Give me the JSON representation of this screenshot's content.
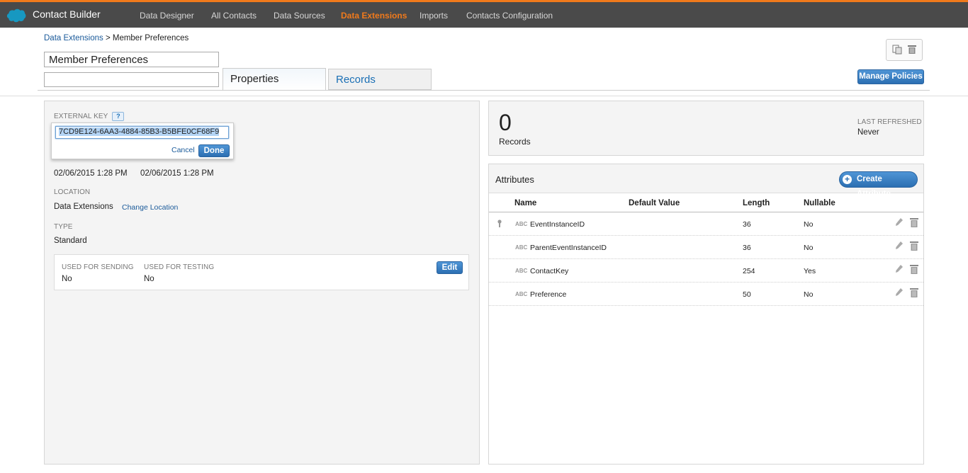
{
  "app": {
    "title": "Contact Builder"
  },
  "nav": [
    {
      "label": "Data Designer",
      "active": false
    },
    {
      "label": "All Contacts",
      "active": false
    },
    {
      "label": "Data Sources",
      "active": false
    },
    {
      "label": "Data Extensions",
      "active": true
    },
    {
      "label": "Imports",
      "active": false
    },
    {
      "label": "Contacts Configuration",
      "active": false
    }
  ],
  "breadcrumb": {
    "parent": "Data Extensions",
    "separator": " > ",
    "current": "Member Preferences"
  },
  "extension": {
    "name": "Member Preferences",
    "description": ""
  },
  "tabs": {
    "properties": "Properties",
    "records": "Records"
  },
  "toolbar": {
    "manage_policies": "Manage Policies"
  },
  "properties": {
    "external_key_label": "EXTERNAL KEY",
    "help": "?",
    "external_key_value": "7CD9E124-6AA3-4884-85B3-B5BFE0CF68F9",
    "cancel": "Cancel",
    "done": "Done",
    "created_value": "02/06/2015 1:28 PM",
    "modified_value": "02/06/2015 1:28 PM",
    "location_label": "LOCATION",
    "location_value": "Data Extensions",
    "change_location": "Change Location",
    "type_label": "TYPE",
    "type_value": "Standard",
    "used_for_sending_label": "USED FOR SENDING",
    "used_for_sending_value": "No",
    "used_for_testing_label": "USED FOR TESTING",
    "used_for_testing_value": "No",
    "edit": "Edit"
  },
  "records": {
    "count": "0",
    "label": "Records",
    "last_refreshed_label": "LAST REFRESHED",
    "last_refreshed_value": "Never"
  },
  "attributes": {
    "title": "Attributes",
    "create": "Create Attribute",
    "columns": {
      "name": "Name",
      "default": "Default Value",
      "length": "Length",
      "nullable": "Nullable"
    },
    "type_icon_text": "ABC",
    "rows": [
      {
        "name": "EventInstanceID",
        "default": "",
        "length": "36",
        "nullable": "No",
        "primary_key": true
      },
      {
        "name": "ParentEventInstanceID",
        "default": "",
        "length": "36",
        "nullable": "No",
        "primary_key": false
      },
      {
        "name": "ContactKey",
        "default": "",
        "length": "254",
        "nullable": "Yes",
        "primary_key": false
      },
      {
        "name": "Preference",
        "default": "",
        "length": "50",
        "nullable": "No",
        "primary_key": false
      }
    ]
  },
  "colors": {
    "accent": "#f07a1c",
    "topbar": "#4a4a4a",
    "link": "#1a5a9a",
    "button": "#2c6fb2"
  }
}
